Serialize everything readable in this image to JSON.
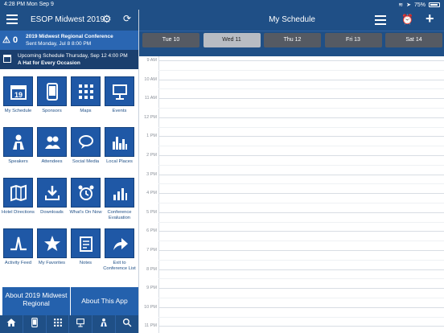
{
  "status": {
    "time": "4:28 PM",
    "date": "Mon Sep 9",
    "battery": "75%"
  },
  "left_header": {
    "title": "ESOP Midwest 2019"
  },
  "notice": {
    "count": "0",
    "title": "2019 Midwest Regional Conference",
    "sent": "Sent Monday, Jul 8 8:00 PM"
  },
  "upcoming": {
    "line1": "Upcoming Schedule Thursday, Sep 12 4:00 PM",
    "line2": "A Hat for Every Occasion"
  },
  "tiles": [
    {
      "label": "My Schedule",
      "icon": "calendar-icon"
    },
    {
      "label": "Sponsors",
      "icon": "mobile-icon"
    },
    {
      "label": "Maps",
      "icon": "grid-icon"
    },
    {
      "label": "Events",
      "icon": "presentation-icon"
    },
    {
      "label": "Speakers",
      "icon": "speaker-icon"
    },
    {
      "label": "Attendees",
      "icon": "people-icon"
    },
    {
      "label": "Social Media",
      "icon": "chat-icon"
    },
    {
      "label": "Local Places",
      "icon": "skyline-icon"
    },
    {
      "label": "Hotel Directions",
      "icon": "map-icon"
    },
    {
      "label": "Downloads",
      "icon": "download-icon"
    },
    {
      "label": "What's On Now",
      "icon": "alarm-icon"
    },
    {
      "label": "Conference Evaluation",
      "icon": "bar-chart-icon"
    },
    {
      "label": "Activity Feed",
      "icon": "activity-icon"
    },
    {
      "label": "My Favorites",
      "icon": "star-icon"
    },
    {
      "label": "Notes",
      "icon": "notes-icon"
    },
    {
      "label": "Exit to Conference List",
      "icon": "share-arrow-icon"
    }
  ],
  "big_buttons": {
    "about_event": "About 2019 Midwest Regional",
    "about_app": "About This App"
  },
  "tabbar": [
    "home-icon",
    "mobile-icon",
    "grid-icon",
    "presentation-icon",
    "speaker-icon",
    "search-icon"
  ],
  "right_header": {
    "title": "My Schedule"
  },
  "days": [
    "Tue 10",
    "Wed 11",
    "Thu 12",
    "Fri 13",
    "Sat 14"
  ],
  "active_day": "Wed 11",
  "hours": [
    "9 AM",
    "10 AM",
    "11 AM",
    "12 PM",
    "1 PM",
    "2 PM",
    "3 PM",
    "4 PM",
    "5 PM",
    "6 PM",
    "7 PM",
    "8 PM",
    "9 PM",
    "10 PM",
    "11 PM"
  ]
}
